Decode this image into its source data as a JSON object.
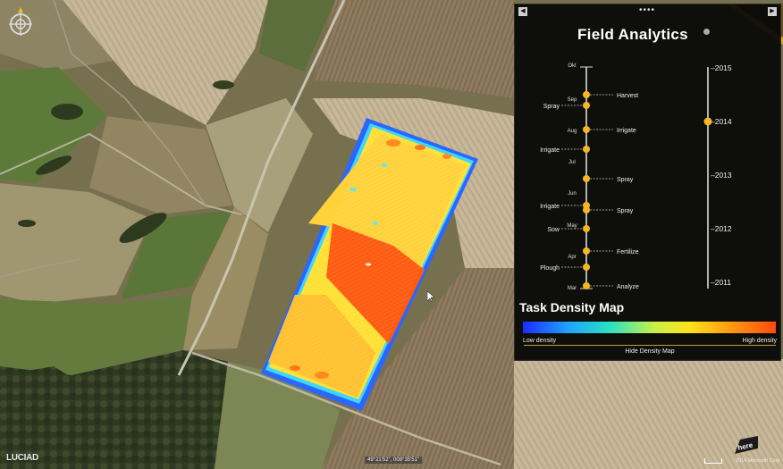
{
  "panel": {
    "title": "Field Analytics",
    "density_title": "Task Density Map",
    "low_label": "Low density",
    "high_label": "High density",
    "hide_label": "Hide Density Map",
    "drag_handle": "••••"
  },
  "timeline": {
    "months": [
      "Okt",
      "Sep",
      "Aug",
      "Jul",
      "Jun",
      "May",
      "Apr",
      "Mar"
    ],
    "tasks_right": [
      "Harvest",
      "Irrigate",
      "Spray",
      "Spray",
      "Fertilize",
      "Analyze"
    ],
    "tasks_left": [
      "Spray",
      "Irrigate",
      "Irrigate",
      "Sow",
      "Plough"
    ]
  },
  "years": {
    "labels": [
      "–2015",
      "–2014",
      "–2013",
      "–2012",
      "–2011"
    ],
    "selected": "2014"
  },
  "map": {
    "coords": "49°21'52\", 008°35'51\"",
    "provider_logo": "LUCIAD",
    "copyright": "2014 Microsoft Corp",
    "here_logo": "here"
  },
  "colors": {
    "accent": "#f5b621",
    "panel_bg": "#060606",
    "density_low": "#1a2cff",
    "density_high": "#ff4a0e"
  },
  "icons": [
    "compass-icon",
    "chevron-left-icon",
    "chevron-right-icon",
    "info-icon",
    "cursor-icon"
  ]
}
